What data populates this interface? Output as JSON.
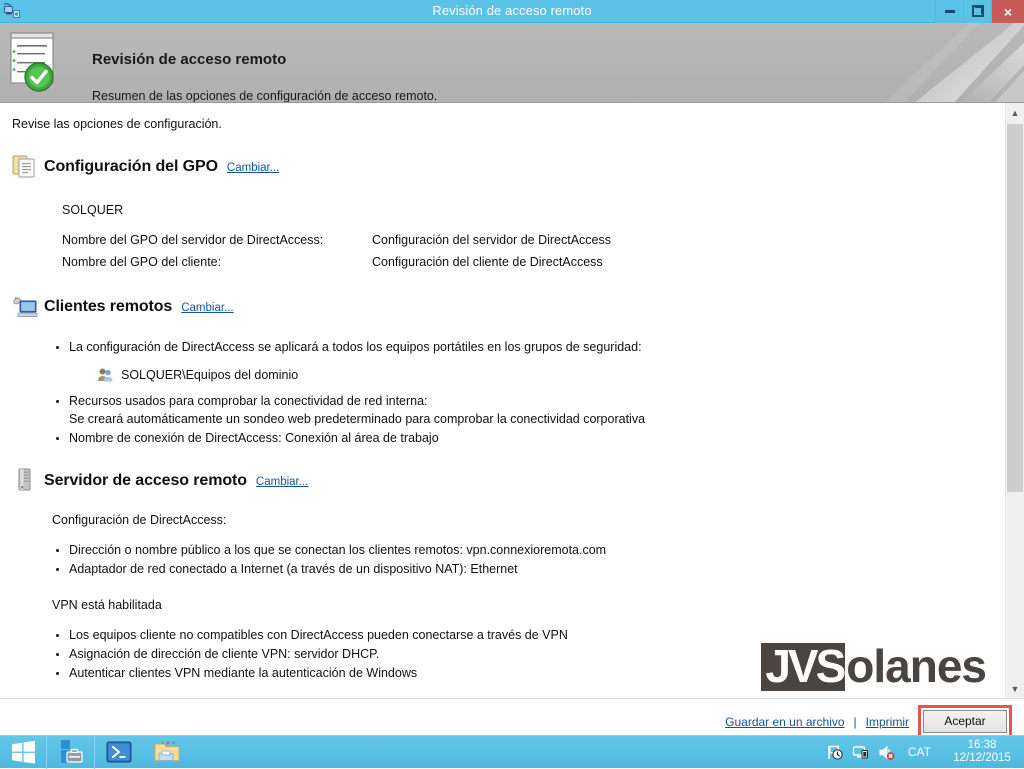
{
  "window": {
    "title": "Revisión de acceso remoto",
    "title_icon": "remote-access-icon",
    "controls": {
      "minimize": "minimize-icon",
      "restore": "restore-icon",
      "close": "×"
    }
  },
  "header": {
    "icon": "checklist-check-icon",
    "title": "Revisión de acceso remoto",
    "subtitle": "Resumen de las opciones de configuración de acceso remoto."
  },
  "content": {
    "intro": "Revise las opciones de configuración.",
    "sections": [
      {
        "icon": "clipboard-document-icon",
        "title": "Configuración del GPO",
        "change_link": "Cambiar...",
        "domain": "SOLQUER",
        "pairs": [
          {
            "key": "Nombre del GPO del servidor de DirectAccess:",
            "value": "Configuración del servidor de DirectAccess"
          },
          {
            "key": "Nombre del GPO del cliente:",
            "value": "Configuración del cliente de DirectAccess"
          }
        ]
      },
      {
        "icon": "remote-client-computer-icon",
        "title": "Clientes remotos",
        "change_link": "Cambiar...",
        "bullet1": "La configuración de DirectAccess se aplicará a todos los equipos portátiles en los grupos de seguridad:",
        "group_icon": "user-group-icon",
        "group_name": "SOLQUER\\Equipos del dominio",
        "bullet2_line1": "Recursos usados para comprobar la conectividad de red interna:",
        "bullet2_line2": "Se creará automáticamente un sondeo web predeterminado para comprobar la conectividad corporativa",
        "bullet3": "Nombre de conexión de DirectAccess: Conexión al área de trabajo"
      },
      {
        "icon": "server-tower-icon",
        "title": "Servidor de acceso remoto",
        "change_link": "Cambiar...",
        "da_heading": "Configuración de DirectAccess:",
        "da_bullets": [
          "Dirección o nombre público a los que se conectan los clientes remotos: vpn.connexioremota.com",
          "Adaptador de red conectado a Internet (a través de un dispositivo NAT): Ethernet"
        ],
        "vpn_heading": "VPN está habilitada",
        "vpn_bullets": [
          "Los equipos cliente no compatibles con DirectAccess pueden conectarse a través de VPN",
          "Asignación de dirección de cliente VPN: servidor DHCP.",
          "Autenticar clientes VPN mediante la autenticación de Windows"
        ]
      }
    ]
  },
  "footer": {
    "save_link": "Guardar en un archivo",
    "separator": "|",
    "print_link": "Imprimir",
    "ok_button": "Aceptar",
    "highlight_color": "#e8554d"
  },
  "watermark": {
    "boxed": "JVS",
    "rest": "olanes"
  },
  "taskbar": {
    "start": "windows-start-icon",
    "items": [
      {
        "icon": "server-manager-icon",
        "name": "server-manager"
      },
      {
        "icon": "powershell-icon",
        "name": "powershell"
      },
      {
        "icon": "file-explorer-icon",
        "name": "file-explorer"
      }
    ],
    "tray": [
      {
        "icon": "flag-action-center-icon"
      },
      {
        "icon": "network-icon"
      },
      {
        "icon": "volume-muted-icon"
      }
    ],
    "language": "CAT",
    "time": "16:38",
    "date": "12/12/2015"
  },
  "colors": {
    "accent": "#5bc2e7",
    "close": "#c75b57",
    "link": "#13539c",
    "header_bg": "#b4b4b4"
  }
}
